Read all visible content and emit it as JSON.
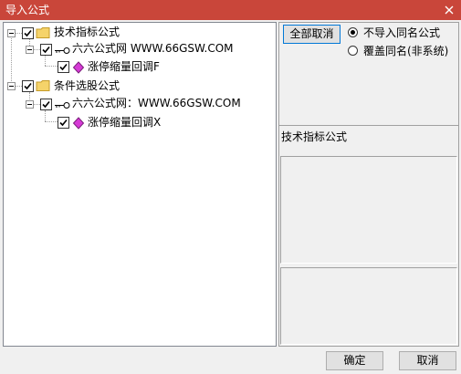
{
  "window": {
    "title": "导入公式",
    "close_icon": "close-icon"
  },
  "tree": {
    "groups": [
      {
        "label": "技术指标公式",
        "icon": "folder-icon",
        "checked": true,
        "expanded": true,
        "source": {
          "label": "六六公式网 WWW.66GSW.COM",
          "icon": "key-icon",
          "checked": true,
          "expanded": true,
          "item": {
            "label": "涨停缩量回调F",
            "icon": "formula-diamond-icon",
            "checked": true
          }
        }
      },
      {
        "label": "条件选股公式",
        "icon": "folder-icon",
        "checked": true,
        "expanded": true,
        "source": {
          "label": "六六公式网：WWW.66GSW.COM",
          "icon": "key-icon",
          "checked": true,
          "expanded": true,
          "item": {
            "label": "涨停缩量回调X",
            "icon": "formula-diamond-icon",
            "checked": true
          }
        }
      }
    ]
  },
  "options": {
    "cancel_all_label": "全部取消",
    "radio_no_import": "不导入同名公式",
    "radio_overwrite": "覆盖同名(非系统)",
    "selected": "不导入同名公式"
  },
  "info": {
    "category_label": "技术指标公式"
  },
  "footer": {
    "ok_label": "确定",
    "cancel_label": "取消"
  }
}
